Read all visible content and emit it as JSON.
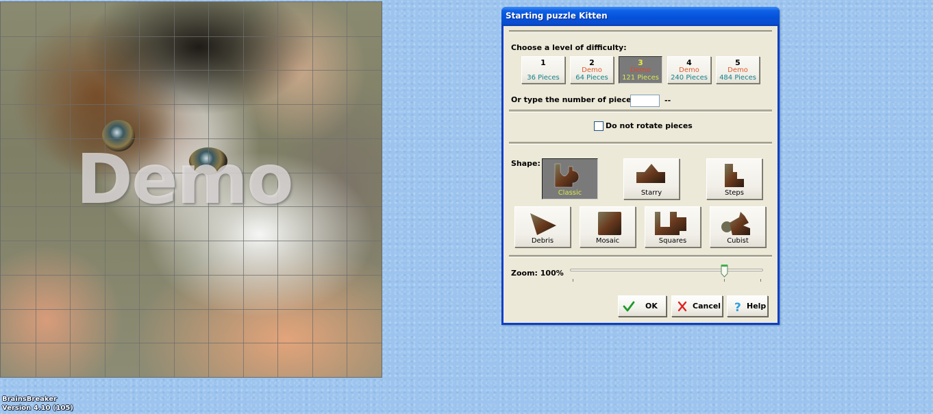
{
  "app": {
    "name": "BrainsBreaker",
    "version": "Version 4.10 (105)"
  },
  "puzzle_preview": {
    "subject": "Kitten",
    "watermark": "Demo",
    "grid_rows": 11,
    "grid_cols": 11
  },
  "dialog": {
    "title": "Starting puzzle Kitten",
    "difficulty_label": "Choose a level of difficulty:",
    "difficulty_levels": [
      {
        "level": "1",
        "demo": "",
        "pieces": "36 Pieces",
        "selected": false
      },
      {
        "level": "2",
        "demo": "Demo",
        "pieces": "64 Pieces",
        "selected": false
      },
      {
        "level": "3",
        "demo": "Demo",
        "pieces": "121 Pieces",
        "selected": true
      },
      {
        "level": "4",
        "demo": "Demo",
        "pieces": "240 Pieces",
        "selected": false
      },
      {
        "level": "5",
        "demo": "Demo",
        "pieces": "484 Pieces",
        "selected": false
      }
    ],
    "pieces_input_label": "Or type the number of pieces:",
    "pieces_input_value": "",
    "pieces_input_suffix": "--",
    "rotate_checkbox_label": "Do not rotate pieces",
    "rotate_checkbox_checked": false,
    "shape_label": "Shape:",
    "shapes": [
      {
        "name": "Classic",
        "selected": true
      },
      {
        "name": "Starry",
        "selected": false
      },
      {
        "name": "Steps",
        "selected": false
      },
      {
        "name": "Debris",
        "selected": false
      },
      {
        "name": "Mosaic",
        "selected": false
      },
      {
        "name": "Squares",
        "selected": false
      },
      {
        "name": "Cubist",
        "selected": false
      }
    ],
    "zoom_label": "Zoom: 100%",
    "zoom_slider_fraction": 0.8,
    "buttons": {
      "ok": "OK",
      "cancel": "Cancel",
      "help": "Help"
    }
  },
  "colors": {
    "titlebar": "#0552da",
    "dialog_bg": "#ece9d8",
    "desktop": "#9cc4ee",
    "demo_text": "#e05a2a",
    "pieces_text": "#14808a",
    "selected_text": "#d8e85a"
  }
}
